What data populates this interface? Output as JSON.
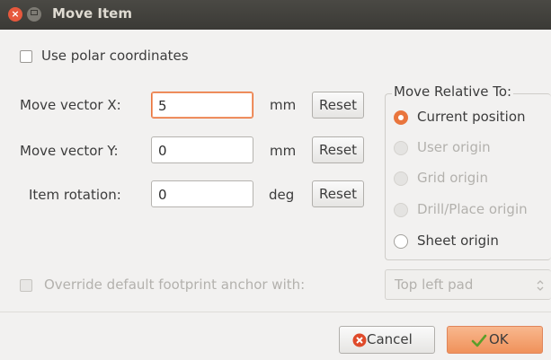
{
  "window": {
    "title": "Move Item",
    "close_glyph": "×"
  },
  "polar_checkbox": {
    "label": "Use polar coordinates",
    "checked": false
  },
  "rows": [
    {
      "label": "Move vector X:",
      "value": "5",
      "unit": "mm",
      "reset_label": "Reset"
    },
    {
      "label": "Move vector Y:",
      "value": "0",
      "unit": "mm",
      "reset_label": "Reset"
    },
    {
      "label": "Item rotation:",
      "value": "0",
      "unit": "deg",
      "reset_label": "Reset"
    }
  ],
  "relative_group": {
    "title": "Move Relative To:",
    "options": [
      {
        "label": "Current position",
        "selected": true,
        "enabled": true
      },
      {
        "label": "User origin",
        "selected": false,
        "enabled": false
      },
      {
        "label": "Grid origin",
        "selected": false,
        "enabled": false
      },
      {
        "label": "Drill/Place origin",
        "selected": false,
        "enabled": false
      },
      {
        "label": "Sheet origin",
        "selected": false,
        "enabled": true
      }
    ]
  },
  "override": {
    "label": "Override default footprint anchor with:",
    "checked": false,
    "enabled": false,
    "selected": "Top left pad"
  },
  "footer": {
    "cancel_label": "Cancel",
    "ok_label": "OK"
  },
  "colors": {
    "accent": "#e9753d",
    "titlebar": "#3c3b37",
    "cancel_icon": "#df4a2a",
    "ok_button": "#f39f6c"
  }
}
